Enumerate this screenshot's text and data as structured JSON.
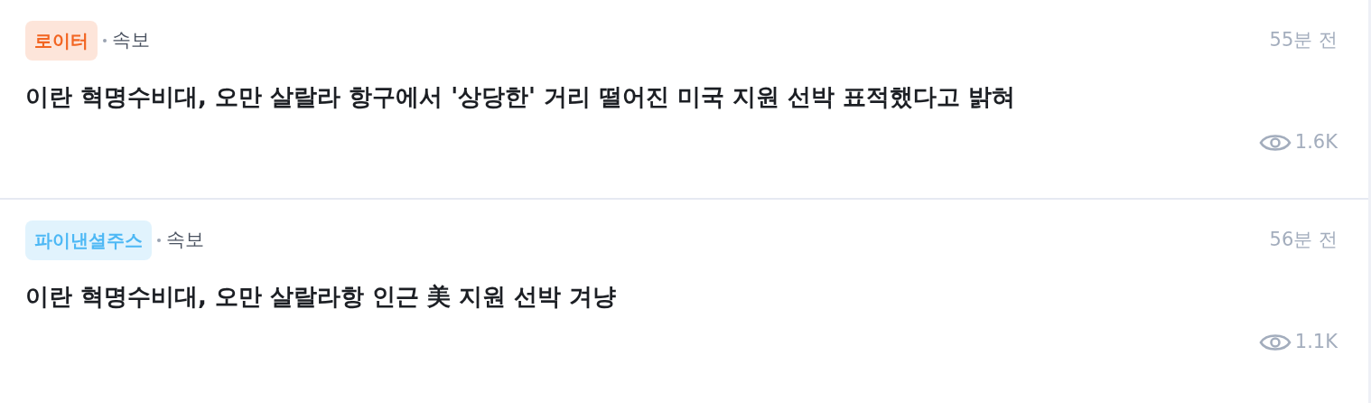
{
  "news_items": [
    {
      "source": "로이터",
      "color": "#f26522",
      "category": "속보",
      "time": "55분 전",
      "title": "이란 혁명수비대, 오만 살랄라 항구에서 '상당한' 거리 떨어진 미국 지원 선박 표적했다고 밝혀",
      "views": "1.6K"
    },
    {
      "source": "파이낸셜주스",
      "color": "#4db8f5",
      "category": "속보",
      "time": "56분 전",
      "title": "이란 혁명수비대, 오만 살랄라항 인근 美 지원 선박 겨냥",
      "views": "1.1K"
    }
  ]
}
